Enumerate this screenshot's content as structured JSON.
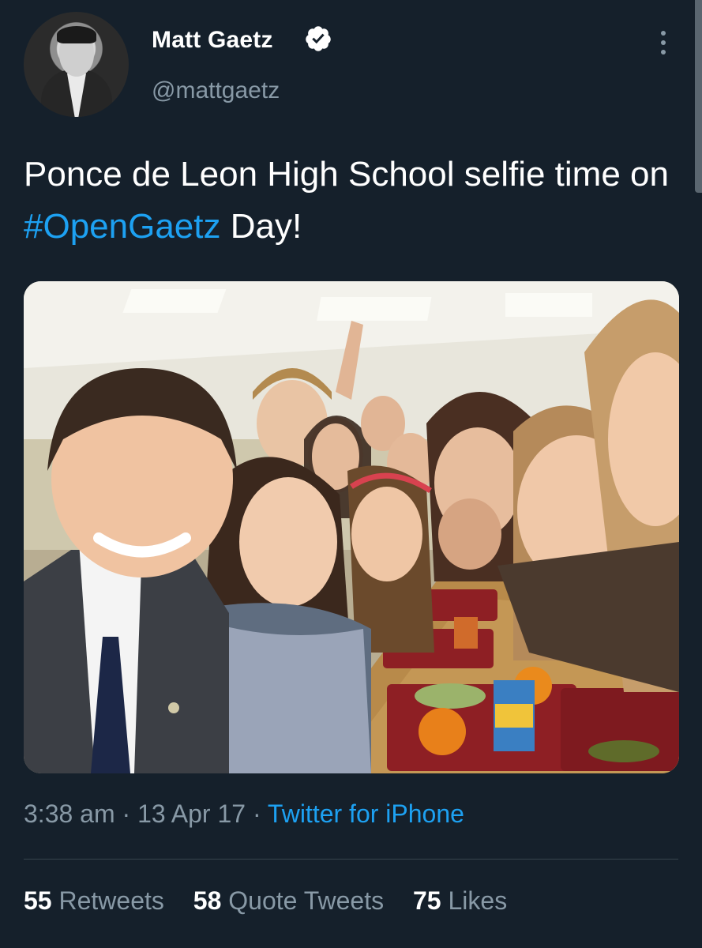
{
  "tweet": {
    "author_name": "Matt Gaetz",
    "author_handle": "@mattgaetz",
    "text_before": "Ponce de Leon High School selfie time on ",
    "hashtag": "#OpenGaetz",
    "text_after": " Day!",
    "time": "3:38 am",
    "date": "13 Apr 17",
    "source": "Twitter for iPhone",
    "separator": " · "
  },
  "stats": {
    "retweets_count": "55",
    "retweets_label": "Retweets",
    "quotes_count": "58",
    "quotes_label": "Quote Tweets",
    "likes_count": "75",
    "likes_label": "Likes"
  },
  "icons": {
    "verified": "verified-badge-icon",
    "more": "more-vertical-icon"
  },
  "colors": {
    "background": "#15202b",
    "link": "#1da1f2",
    "secondary_text": "#8899a6",
    "divider": "#38444d"
  }
}
